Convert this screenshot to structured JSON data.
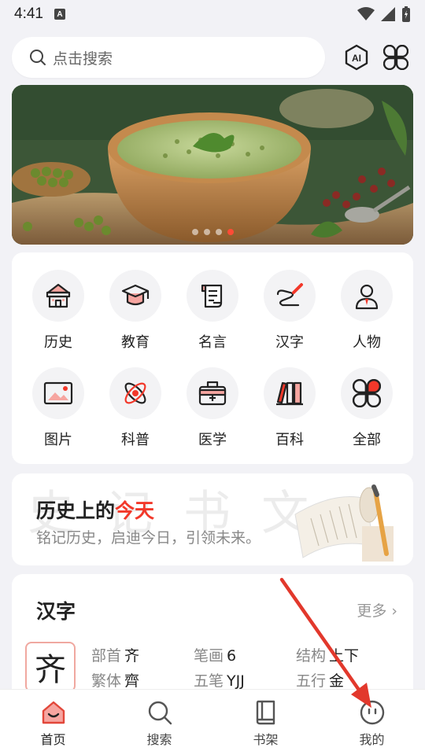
{
  "status_bar": {
    "time": "4:41",
    "notif_letter": "A"
  },
  "search": {
    "placeholder": "点击搜索"
  },
  "top_icons": {
    "ai_label": "AI"
  },
  "banner": {
    "dots": 4,
    "active_dot": 3
  },
  "categories": [
    {
      "label": "历史",
      "icon": "house-icon"
    },
    {
      "label": "教育",
      "icon": "graduation-cap-icon"
    },
    {
      "label": "名言",
      "icon": "scroll-icon"
    },
    {
      "label": "汉字",
      "icon": "pen-icon"
    },
    {
      "label": "人物",
      "icon": "person-icon"
    },
    {
      "label": "图片",
      "icon": "image-icon"
    },
    {
      "label": "科普",
      "icon": "atom-icon"
    },
    {
      "label": "医学",
      "icon": "medkit-icon"
    },
    {
      "label": "百科",
      "icon": "books-icon"
    },
    {
      "label": "全部",
      "icon": "grid-icon"
    }
  ],
  "today": {
    "title_prefix": "历史上的",
    "title_highlight": "今天",
    "subtitle": "铭记历史，启迪今日，引领未来。"
  },
  "hanzi": {
    "title": "汉字",
    "more": "更多",
    "character": "齐",
    "radical_key": "部首",
    "radical_val": "齐",
    "strokes_key": "笔画",
    "strokes_val": "6",
    "structure_key": "结构",
    "structure_val": "上下",
    "traditional_key": "繁体",
    "traditional_val": "齊",
    "wubi_key": "五笔",
    "wubi_val": "YJJ",
    "element_key": "五行",
    "element_val": "金"
  },
  "nav": [
    {
      "label": "首页",
      "active": true
    },
    {
      "label": "搜索",
      "active": false
    },
    {
      "label": "书架",
      "active": false
    },
    {
      "label": "我的",
      "active": false
    }
  ],
  "colors": {
    "accent": "#f2382a",
    "bg": "#f2f2f6"
  }
}
